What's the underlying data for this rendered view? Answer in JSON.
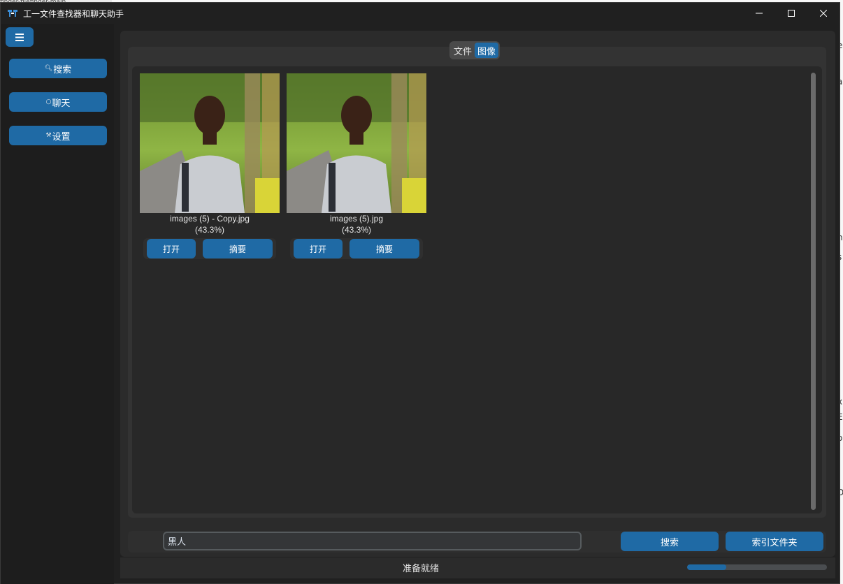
{
  "window": {
    "title": "工一文件查找器和聊天助手"
  },
  "background_app": {
    "top_left_text": "finder-filefinder-main",
    "right_letters": [
      "e",
      "a",
      "n",
      "s",
      "x",
      "E",
      "o",
      "D"
    ]
  },
  "sidebar": {
    "menu_icon": "hamburger-icon",
    "items": [
      {
        "label": "搜索",
        "icon": "search-icon"
      },
      {
        "label": "聊天",
        "icon": "chat-bubble-icon"
      },
      {
        "label": "设置",
        "icon": "tools-icon"
      }
    ]
  },
  "tabs": {
    "items": [
      {
        "label": "文件",
        "active": false
      },
      {
        "label": "图像",
        "active": true
      }
    ]
  },
  "results": [
    {
      "name": "images (5) - Copy.jpg",
      "score": "(43.3%)",
      "open_label": "打开",
      "summary_label": "摘要"
    },
    {
      "name": "images (5).jpg",
      "score": "(43.3%)",
      "open_label": "打开",
      "summary_label": "摘要"
    }
  ],
  "search": {
    "value": "黑人",
    "search_label": "搜索",
    "index_label": "索引文件夹"
  },
  "status": {
    "text": "准备就绪",
    "progress": 0.28
  },
  "colors": {
    "accent": "#1f6aa5",
    "window_bg": "#202020",
    "panel_bg": "#2b2b2b"
  }
}
